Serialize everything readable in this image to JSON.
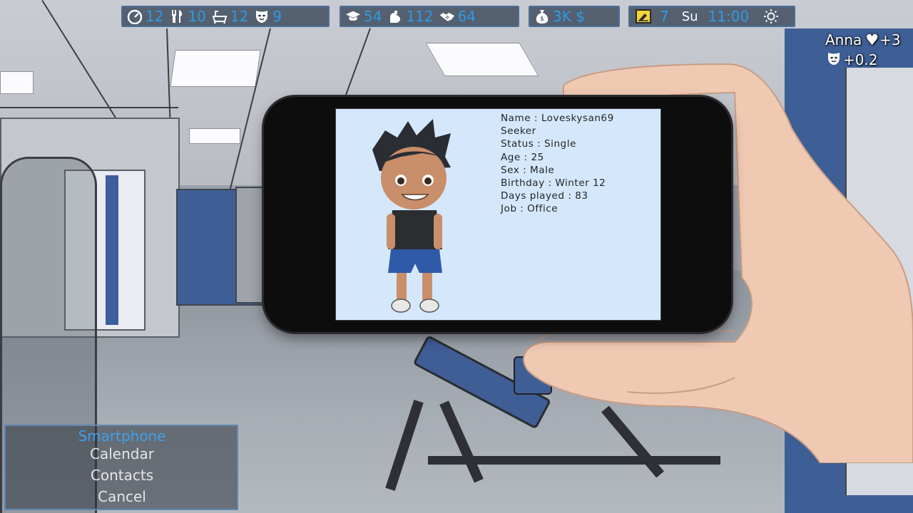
{
  "hud": {
    "needs": [
      {
        "icon": "energy-gauge-icon",
        "value": "12"
      },
      {
        "icon": "fork-knife-icon",
        "value": "10"
      },
      {
        "icon": "bathtub-icon",
        "value": "12"
      },
      {
        "icon": "mask-icon",
        "value": "9"
      }
    ],
    "skills": [
      {
        "icon": "graduation-cap-icon",
        "value": "54"
      },
      {
        "icon": "flexed-arm-icon",
        "value": "112"
      },
      {
        "icon": "handshake-icon",
        "value": "64"
      }
    ],
    "money": {
      "icon": "money-bag-icon",
      "value": "3K $"
    },
    "time": {
      "icon": "calendar-icon",
      "date": "7",
      "day": "Su",
      "clock": "11:00",
      "weather_icon": "sun-icon"
    }
  },
  "status_notifications": {
    "name": "Anna",
    "love_delta": "+3",
    "mask_delta": "+0.2"
  },
  "phone": {
    "profile": [
      "Name : Loveskysan69",
      "Seeker",
      "Status : Single",
      "Age : 25",
      "Sex : Male",
      "Birthday : Winter 12",
      "Days played : 83",
      "Job : Office"
    ]
  },
  "menu": {
    "title": "Smartphone",
    "items": [
      "Calendar",
      "Contacts",
      "Cancel"
    ]
  },
  "colors": {
    "hud_value": "#2f9ae3",
    "menu_title": "#3da0e8",
    "screen_bg": "#d5e8fb",
    "date_badge": "#f3d63a"
  }
}
